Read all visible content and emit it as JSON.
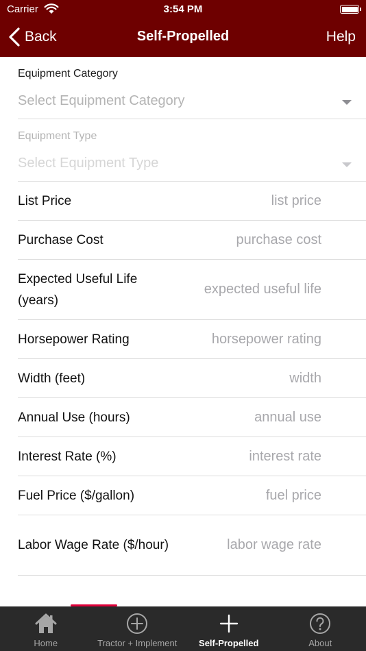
{
  "status_bar": {
    "carrier": "Carrier",
    "time": "3:54 PM"
  },
  "nav": {
    "back_label": "Back",
    "title": "Self-Propelled",
    "help_label": "Help"
  },
  "pickers": [
    {
      "label": "Equipment Category",
      "placeholder": "Select Equipment Category",
      "enabled": true
    },
    {
      "label": "Equipment Type",
      "placeholder": "Select Equipment Type",
      "enabled": false
    }
  ],
  "fields": [
    {
      "label": "List Price",
      "placeholder": "list price",
      "value": ""
    },
    {
      "label": "Purchase Cost",
      "placeholder": "purchase cost",
      "value": ""
    },
    {
      "label": "Expected Useful Life (years)",
      "placeholder": "expected useful life",
      "value": ""
    },
    {
      "label": "Horsepower Rating",
      "placeholder": "horsepower rating",
      "value": ""
    },
    {
      "label": "Width (feet)",
      "placeholder": "width",
      "value": ""
    },
    {
      "label": "Annual Use (hours)",
      "placeholder": "annual use",
      "value": ""
    },
    {
      "label": "Interest Rate (%)",
      "placeholder": "interest rate",
      "value": ""
    },
    {
      "label": "Fuel Price ($/gallon)",
      "placeholder": "fuel price",
      "value": ""
    },
    {
      "label": "Labor Wage Rate ($/hour)",
      "placeholder": "labor wage rate",
      "value": ""
    }
  ],
  "tabs": [
    {
      "label": "Home",
      "icon": "home-icon",
      "active": false
    },
    {
      "label": "Tractor + Implement",
      "icon": "plus-circle-icon",
      "active": false
    },
    {
      "label": "Self-Propelled",
      "icon": "plus-icon",
      "active": true
    },
    {
      "label": "About",
      "icon": "question-circle-icon",
      "active": false
    }
  ],
  "colors": {
    "header_bg": "#6e0000",
    "tabbar_bg": "#2a2a2a",
    "accent": "#e0003a"
  }
}
